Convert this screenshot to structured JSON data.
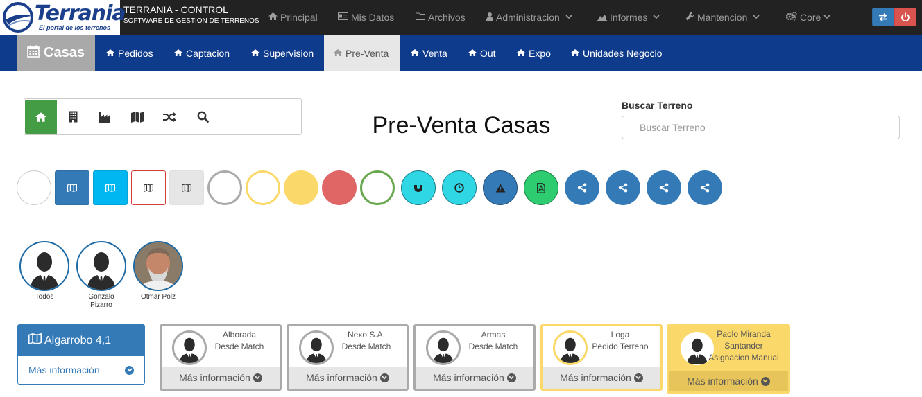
{
  "brand": {
    "name": "Terrania",
    "tagline": "El portal de los terrenos"
  },
  "app": {
    "title": "TERRANIA - CONTROL",
    "subtitle": "SOFTWARE DE GESTION DE TERRENOS"
  },
  "topnav": [
    {
      "label": "Principal",
      "icon": "home-icon"
    },
    {
      "label": "Mis Datos",
      "icon": "id-card-icon"
    },
    {
      "label": "Archivos",
      "icon": "folder-icon"
    },
    {
      "label": "Administracion",
      "icon": "user-icon",
      "dropdown": true
    },
    {
      "label": "Informes",
      "icon": "area-chart-icon",
      "dropdown": true
    },
    {
      "label": "Mantencion",
      "icon": "wrench-icon",
      "dropdown": true
    },
    {
      "label": "Core",
      "icon": "gears-icon",
      "dropdown": true
    }
  ],
  "topbuttons": {
    "swap": "swap-icon",
    "power": "power-icon"
  },
  "subnav": {
    "section": "Casas",
    "items": [
      {
        "label": "Pedidos",
        "active": false
      },
      {
        "label": "Captacion",
        "active": false
      },
      {
        "label": "Supervision",
        "active": false
      },
      {
        "label": "Pre-Venta",
        "active": true
      },
      {
        "label": "Venta",
        "active": false
      },
      {
        "label": "Out",
        "active": false
      },
      {
        "label": "Expo",
        "active": false
      },
      {
        "label": "Unidades Negocio",
        "active": false
      }
    ]
  },
  "toolbar": [
    "home-icon",
    "building-icon",
    "industry-icon",
    "map-icon",
    "random-icon",
    "search-icon"
  ],
  "page": {
    "title": "Pre-Venta Casas"
  },
  "search": {
    "label": "Buscar Terreno",
    "placeholder": "Buscar Terreno"
  },
  "colors": {
    "primary": "#337ab7",
    "navy": "#0f3b8c",
    "success": "#449d44",
    "warning": "#fad86a",
    "danger": "#e06666",
    "info": "#2fd6e3"
  },
  "users": [
    {
      "name": "Todos"
    },
    {
      "name": "Gonzalo Pizarro"
    },
    {
      "name": "Otmar Polz"
    }
  ],
  "terreno": {
    "title": "Algarrobo 4,1",
    "more": "Más información"
  },
  "cards": [
    {
      "name": "Alborada",
      "status": "Desde Match",
      "more": "Más información"
    },
    {
      "name": "Nexo S.A.",
      "status": "Desde Match",
      "more": "Más información"
    },
    {
      "name": "Armas",
      "status": "Desde Match",
      "more": "Más información"
    },
    {
      "name": "Loga",
      "status": "Pedido Terreno",
      "more": "Más información"
    },
    {
      "name": "Paolo Miranda Santander",
      "status": "Asignacion Manual",
      "more": "Más información"
    }
  ]
}
